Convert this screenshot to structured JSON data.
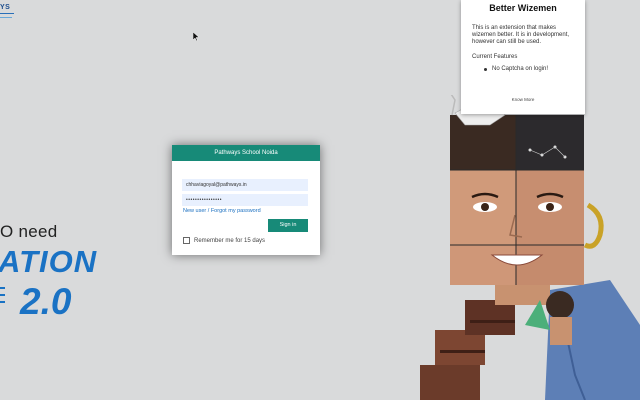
{
  "logo": {
    "text": "YS"
  },
  "hero": {
    "tagline": "O need",
    "brand_word": "ATION",
    "brand_version": "2.0"
  },
  "login": {
    "header": "Pathways School Noida",
    "username_value": "chhaviagoyal@pathways.in",
    "password_mask": "••••••••••••••••",
    "forgot_link": "New user / Forgot my password",
    "signin_label": "Sign in",
    "remember_label": "Remember me for 15 days",
    "remember_checked": false
  },
  "extension_popup": {
    "title": "Better Wizemen",
    "description": "This is an extension that makes wizemen better. It is in development, however can still be used.",
    "features_heading": "Current Features",
    "features": [
      "No Captcha on login!"
    ],
    "link": "Know More"
  },
  "colors": {
    "background": "#d9dadb",
    "login_accent": "#178a78",
    "brand_blue": "#1a72c4",
    "link_blue": "#1a6fc0"
  }
}
